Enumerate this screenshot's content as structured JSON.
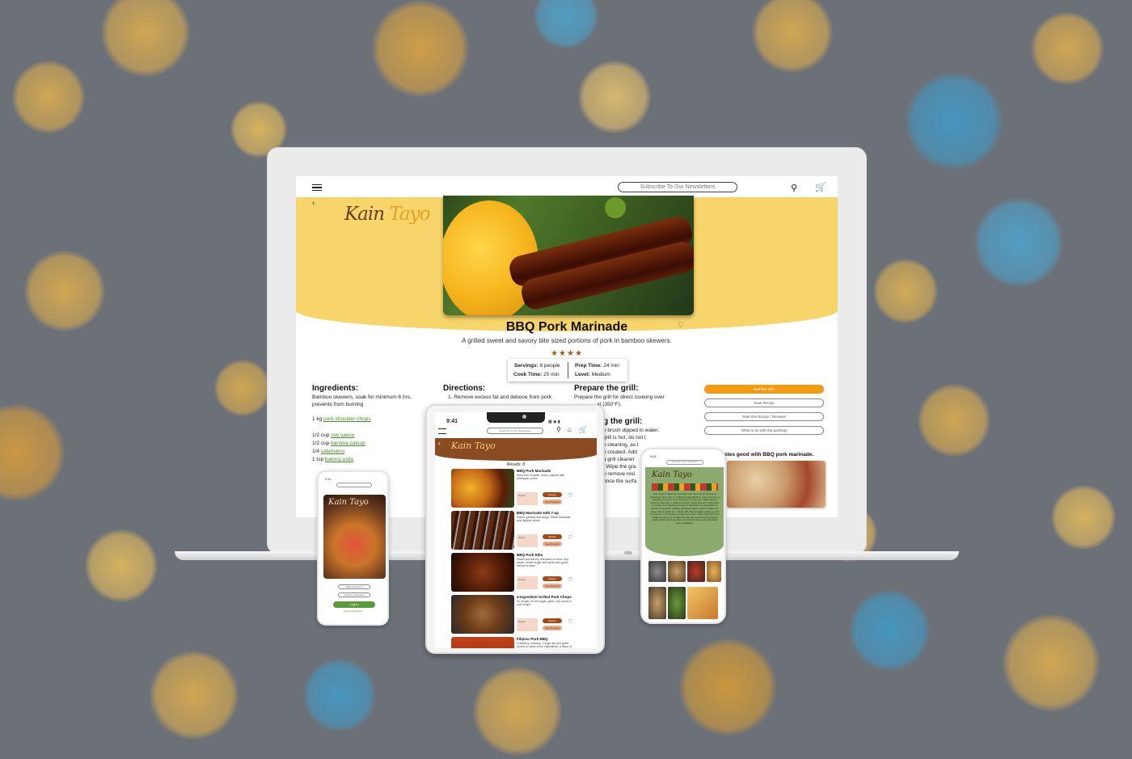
{
  "desktop": {
    "newsletter_placeholder": "Subscribe To Our Newsletters",
    "logo": {
      "main": "Kain ",
      "accent": "Tayo"
    },
    "recipe_title": "BBQ Pork Marinade",
    "recipe_subtitle": "A grilled sweet and savory bite sized portions of pork in bamboo skewers.",
    "rating_stars": "★★★★",
    "info": {
      "servings_label": "Servings:",
      "servings_value": "8 people",
      "prep_label": "Prep Time:",
      "prep_value": "24 min",
      "cook_label": "Cook Time:",
      "cook_value": "20 min",
      "level_label": "Level:",
      "level_value": "Medium"
    },
    "ingredients": {
      "heading": "Ingredients:",
      "note": "Bamboo skewers, soak for minimum 6 hrs. prevents from burning",
      "items": [
        {
          "qty": "1 kg",
          "name": "pork shoulder chops"
        },
        {
          "qty": "1/2 cup",
          "name": "soy sauce"
        },
        {
          "qty": "1/2 cup",
          "name": "banana catsup"
        },
        {
          "qty": "1/4",
          "name": "calamansi"
        },
        {
          "qty": "1 tsp",
          "name": "baking soda"
        }
      ]
    },
    "directions": {
      "heading": "Directions:",
      "step1": "1. Remove excess fat and debone from pork"
    },
    "grill": {
      "heading": "Prepare the grill:",
      "text": "Prepare the grill for direct cooking over",
      "text2": "at (350°F).",
      "heading2": "g the grill:",
      "lines": [
        "e brush dipped in water.",
        "grill is hot, do not l",
        "e cleaning, as t",
        "e created. Add",
        "a grill cleaner",
        ". Wipe the gra",
        "o remove resi",
        "once the surfa"
      ]
    },
    "side_buttons": [
      "Nutrition Info",
      "Save Recipe",
      "Rate this Recipe / Reviews",
      "What to do with the peelings"
    ],
    "side_heading": "stes good with BBQ pork marinade."
  },
  "phone_left": {
    "time": "9:41",
    "field1": "Make Password",
    "field2": "Confirm Password",
    "login": "Log In",
    "forgot": "Forgot Password"
  },
  "tablet": {
    "time": "9:41",
    "search_placeholder": "Subscribe To Our Newsletters",
    "results": "Results: 8",
    "recipes": [
      {
        "name": "BBQ Pork Marinade",
        "desc": "Spicy mix of garlic, onion, paprika with pineapple sauce."
      },
      {
        "name": "BBQ Marinade with 7-up",
        "desc": "Sweet, garlicky and tangy. Share marinade and dipping sauce."
      },
      {
        "name": "BBQ Pork Ribs",
        "desc": "Sweet and savory marinade of onion, soy sauce, brown sugar with sprite and garlic. Savory to start."
      },
      {
        "name": "4-Ingredient Grilled Pork Chops",
        "desc": "So simple: brown sugar, garlic, soy sauce & pork chops."
      },
      {
        "name": "Filipino Pork BBQ",
        "desc": "Cranberry, Ketchup, Ginger ale and garlic cloves to name a few ingredients, a flavor of the sea."
      }
    ],
    "btn_primary": "Recipe",
    "btn_secondary": "See Reviews"
  },
  "phone_right": {
    "time": "9:41",
    "search_placeholder": "Subscribe To Our Newsletters",
    "about": "Kain Tayo's meaning \"Let's Eat\" was born out of the love of learning to find ways to substitute ingredients in order to feed my daughter. I love to cook but found it extremely challenging to feed my child who is allergic to food. Going through recipe sites to recipe sites figuring out how to substitute one ingredient to another ingredient. Making substitute sauces just to make one recipe was a nightmare. I dealt with daily struggle ending up with a minimum of 4 recipes to make one meal. I knew that had to be a different way so I created this site. By combining the Filipino recipes that I grew up with and showing that every ingredient has a substitute."
  },
  "colors": {
    "accent": "#f39c12",
    "brand_brown": "#8a4a22",
    "hero_yellow": "#f7d56b",
    "link_green": "#4a8a2a"
  }
}
